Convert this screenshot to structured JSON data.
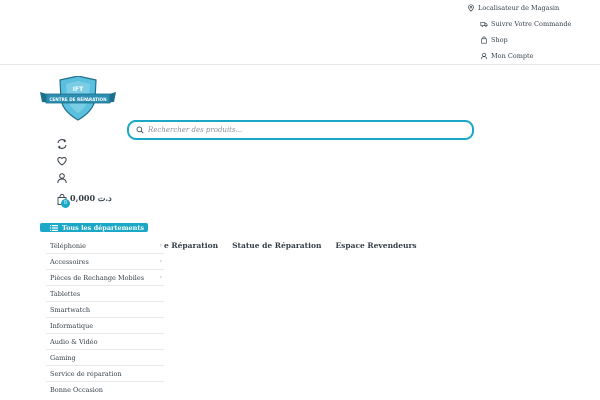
{
  "topbar": {
    "links": [
      {
        "label": "Localisateur de Magasin",
        "icon": "map-marker-icon"
      },
      {
        "label": "Suivre Votre Commande",
        "icon": "truck-icon"
      },
      {
        "label": "Shop",
        "icon": "shopping-bag-icon"
      },
      {
        "label": "Mon Compte",
        "icon": "user-icon"
      }
    ]
  },
  "logo": {
    "text": "CENTRE DE RÉPARATION",
    "top": "IFT"
  },
  "search": {
    "placeholder": "Rechercher des produits..."
  },
  "header": {
    "cart_amount": "0,000 د.ت",
    "cart_count": "0"
  },
  "departments": {
    "button_label": "Tous les départements",
    "items": [
      {
        "label": "Téléphonie",
        "has_sub": true
      },
      {
        "label": "Accessoires",
        "has_sub": true
      },
      {
        "label": "Pièces de Rechange Mobiles",
        "has_sub": true
      },
      {
        "label": "Tablettes",
        "has_sub": false
      },
      {
        "label": "Smartwatch",
        "has_sub": false
      },
      {
        "label": "Informatique",
        "has_sub": false
      },
      {
        "label": "Audio & Vidéo",
        "has_sub": false
      },
      {
        "label": "Gaming",
        "has_sub": false
      },
      {
        "label": "Service de réparation",
        "has_sub": false
      },
      {
        "label": "Bonne Occasion",
        "has_sub": false
      }
    ]
  },
  "main_nav": {
    "items": [
      "e Réparation",
      "Statue de Réparation",
      "Espace Revendeurs"
    ]
  },
  "colors": {
    "accent": "#1ba8c7",
    "text": "#333e48"
  }
}
